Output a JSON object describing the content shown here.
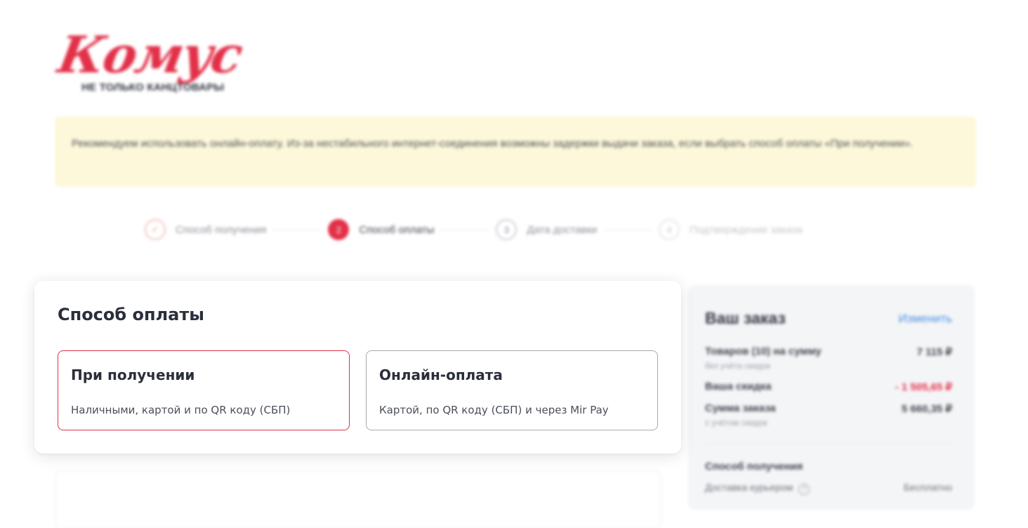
{
  "brand": {
    "logo_text": "Комус",
    "tagline": "НЕ ТОЛЬКО КАНЦТОВАРЫ",
    "accent_color": "#e23048"
  },
  "notice": {
    "text": "Рекомендуем использовать онлайн-оплату. Из-за нестабильного интернет-соединения возможны задержки выдачи заказа, если выбрать способ оплаты «При получении»."
  },
  "steps": [
    {
      "number": "✓",
      "label": "Способ получения",
      "state": "done"
    },
    {
      "number": "2",
      "label": "Способ оплаты",
      "state": "active"
    },
    {
      "number": "3",
      "label": "Дата доставки",
      "state": "next"
    },
    {
      "number": "4",
      "label": "Подтверждение заказа",
      "state": "future"
    }
  ],
  "payment": {
    "title": "Способ оплаты",
    "options": [
      {
        "title": "При получении",
        "description": "Наличными, картой и по QR коду (СБП)",
        "selected": true
      },
      {
        "title": "Онлайн-оплата",
        "description": "Картой, по QR коду (СБП) и через Mir Pay",
        "selected": false
      }
    ]
  },
  "order": {
    "title": "Ваш заказ",
    "edit_label": "Изменить",
    "items_label": "Товаров (10) на сумму",
    "items_value": "7 115 ₽",
    "items_note": "без учёта скидок",
    "discount_label": "Ваша скидка",
    "discount_value": "- 1 505,65 ₽",
    "total_label": "Сумма заказа",
    "total_value": "5 660,35 ₽",
    "total_note": "с учётом скидок",
    "section_title": "Способ получения",
    "delivery_label": "Доставка курьером",
    "delivery_value": "Бесплатно"
  }
}
